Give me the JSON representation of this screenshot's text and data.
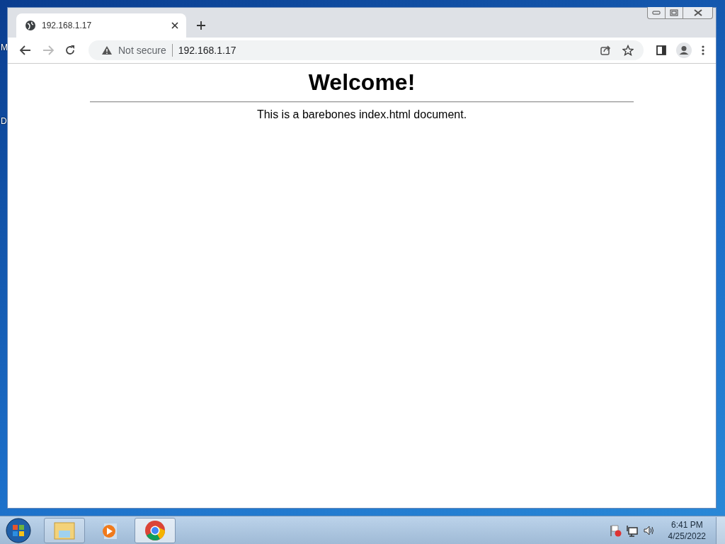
{
  "desktop": {
    "icon_labels": [
      "M",
      "D"
    ]
  },
  "browser": {
    "tabs": [
      {
        "title": "192.168.1.17",
        "selected": true
      }
    ],
    "toolbar": {
      "security_label": "Not secure",
      "url": "192.168.1.17",
      "forward_disabled": true
    }
  },
  "page": {
    "heading": "Welcome!",
    "paragraph": "This is a barebones index.html document."
  },
  "taskbar": {
    "items": [
      {
        "kind": "explorer",
        "running": true,
        "selected": false
      },
      {
        "kind": "media",
        "running": false,
        "selected": false
      },
      {
        "kind": "chrome",
        "running": true,
        "selected": true
      }
    ],
    "clock": {
      "time": "6:41 PM",
      "date": "4/25/2022"
    }
  }
}
